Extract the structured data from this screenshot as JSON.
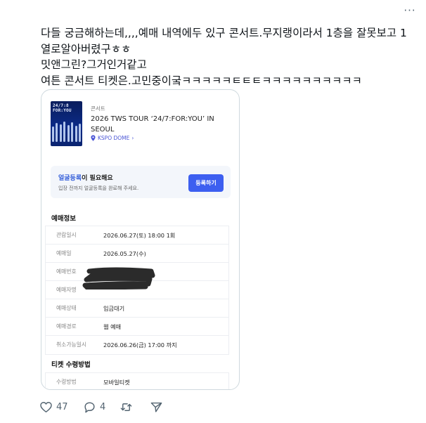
{
  "tweet": {
    "more_glyph": "···",
    "text_lines": [
      "다들 궁금해하는데,,,,예매 내역에두 있구 콘서트.무지랭이라서 1층을 잘못보고 1",
      "열로알아버렸구ㅎㅎ",
      "밋앤그린?그거인거같고",
      "여튼 콘서트 티켓은.고민중이궄ㅋㅋㅋㅋㅋㅌㅌㅌㅋㅋㅋㅋㅋㅋㅋㅋㅋㅋ"
    ],
    "stats": {
      "likes": "47",
      "replies": "4"
    }
  },
  "ticket": {
    "poster_text": [
      "24/7:8",
      "FOR:YOU"
    ],
    "category": "콘서트",
    "title": "2026 TWS TOUR ‘24/7:FOR:YOU’ IN SEOUL",
    "venue": "KSPO DOME",
    "venue_chevron": "›",
    "face_registration": {
      "title_highlight": "얼굴등록",
      "title_rest": "이 필요해요",
      "subtitle": "입장 전까지 얼굴등록을 완료해 주세요.",
      "button": "등록하기"
    },
    "booking_info": {
      "title": "예매정보",
      "rows": [
        {
          "key": "관람일시",
          "value": "2026.06.27(토) 18:00 1회"
        },
        {
          "key": "예매일",
          "value": "2026.05.27(수)"
        },
        {
          "key": "예매번호",
          "value": ""
        },
        {
          "key": "예매자명",
          "value": ""
        },
        {
          "key": "예매상태",
          "value": "입금대기"
        },
        {
          "key": "예매경로",
          "value": "웹 예매"
        },
        {
          "key": "취소가능일시",
          "value": "2026.06.26(금) 17:00 까지"
        }
      ]
    },
    "receive_method": {
      "title": "티켓 수령방법",
      "rows": [
        {
          "key": "수령방법",
          "value": "모바일티켓"
        }
      ]
    }
  },
  "colors": {
    "accent": "#3d5ff0",
    "link": "#4a55d6",
    "icon_gray": "#536471",
    "border": "#cfd9de"
  },
  "icons": [
    "more-icon",
    "location-pin-icon",
    "heart-icon",
    "reply-icon",
    "retweet-icon",
    "share-icon"
  ]
}
